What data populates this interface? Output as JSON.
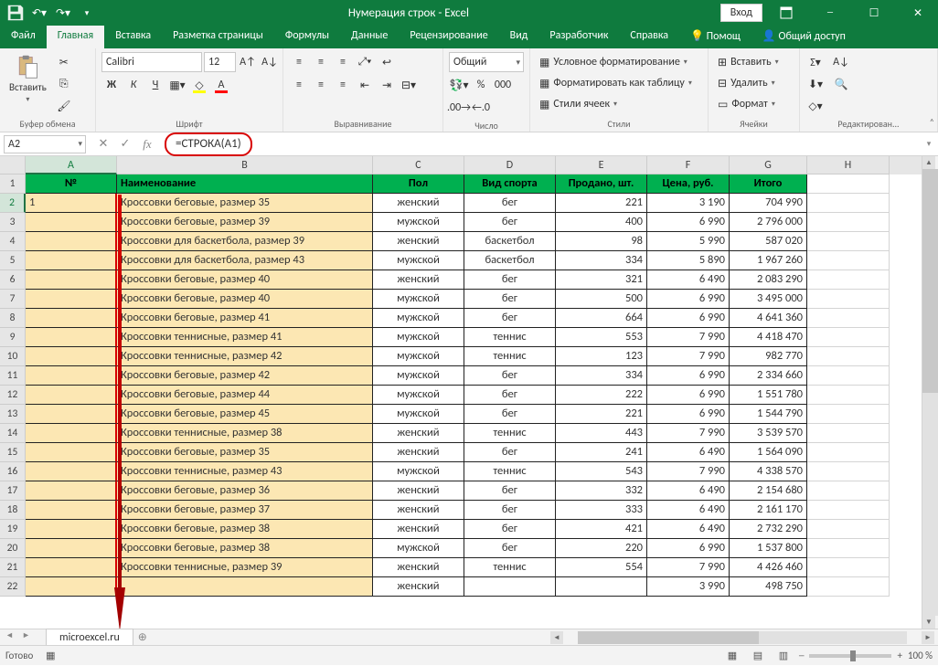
{
  "title": "Нумерация строк  -  Excel",
  "signin": "Вход",
  "tabs": [
    "Файл",
    "Главная",
    "Вставка",
    "Разметка страницы",
    "Формулы",
    "Данные",
    "Рецензирование",
    "Вид",
    "Разработчик",
    "Справка",
    "Помощ",
    "Общий доступ"
  ],
  "active_tab": 1,
  "ribbon": {
    "clipboard": {
      "paste": "Вставить",
      "label": "Буфер обмена"
    },
    "font": {
      "name": "Calibri",
      "size": "12",
      "label": "Шрифт",
      "bold": "Ж",
      "italic": "К",
      "underline": "Ч"
    },
    "align": {
      "label": "Выравнивание"
    },
    "number": {
      "format": "Общий",
      "label": "Число"
    },
    "styles": {
      "cond": "Условное форматирование",
      "table": "Форматировать как таблицу",
      "cell": "Стили ячеек",
      "label": "Стили"
    },
    "cells": {
      "insert": "Вставить",
      "delete": "Удалить",
      "format": "Формат",
      "label": "Ячейки"
    },
    "editing": {
      "label": "Редактирован..."
    }
  },
  "namebox": "A2",
  "formula": "=СТРОКА(A1)",
  "cols": {
    "A": 100,
    "B": 280,
    "C": 100,
    "D": 100,
    "E": 100,
    "F": 90,
    "G": 85,
    "H": 90
  },
  "headers": {
    "A": "№",
    "B": "Наименование",
    "C": "Пол",
    "D": "Вид спорта",
    "E": "Продано, шт.",
    "F": "Цена, руб.",
    "G": "Итого"
  },
  "a2": "1",
  "rows": [
    {
      "b": "Кроссовки беговые, размер 35",
      "c": "женский",
      "d": "бег",
      "e": "221",
      "f": "3 190",
      "g": "704 990"
    },
    {
      "b": "Кроссовки беговые, размер 39",
      "c": "мужской",
      "d": "бег",
      "e": "400",
      "f": "6 990",
      "g": "2 796 000"
    },
    {
      "b": "Кроссовки для баскетбола, размер 39",
      "c": "женский",
      "d": "баскетбол",
      "e": "98",
      "f": "5 990",
      "g": "587 020"
    },
    {
      "b": "Кроссовки для баскетбола, размер 43",
      "c": "мужской",
      "d": "баскетбол",
      "e": "334",
      "f": "5 890",
      "g": "1 967 260"
    },
    {
      "b": "Кроссовки беговые, размер 40",
      "c": "женский",
      "d": "бег",
      "e": "321",
      "f": "6 490",
      "g": "2 083 290"
    },
    {
      "b": "Кроссовки беговые, размер 40",
      "c": "мужской",
      "d": "бег",
      "e": "500",
      "f": "6 990",
      "g": "3 495 000"
    },
    {
      "b": "Кроссовки беговые, размер 41",
      "c": "мужской",
      "d": "бег",
      "e": "664",
      "f": "6 990",
      "g": "4 641 360"
    },
    {
      "b": "Кроссовки теннисные, размер 41",
      "c": "мужской",
      "d": "теннис",
      "e": "553",
      "f": "7 990",
      "g": "4 418 470"
    },
    {
      "b": "Кроссовки теннисные, размер 42",
      "c": "мужской",
      "d": "теннис",
      "e": "123",
      "f": "7 990",
      "g": "982 770"
    },
    {
      "b": "Кроссовки беговые, размер 42",
      "c": "мужской",
      "d": "бег",
      "e": "334",
      "f": "6 990",
      "g": "2 334 660"
    },
    {
      "b": "Кроссовки беговые, размер 44",
      "c": "мужской",
      "d": "бег",
      "e": "222",
      "f": "6 990",
      "g": "1 551 780"
    },
    {
      "b": "Кроссовки беговые, размер 45",
      "c": "мужской",
      "d": "бег",
      "e": "221",
      "f": "6 990",
      "g": "1 544 790"
    },
    {
      "b": "Кроссовки теннисные, размер 38",
      "c": "женский",
      "d": "теннис",
      "e": "443",
      "f": "7 990",
      "g": "3 539 570"
    },
    {
      "b": "Кроссовки беговые, размер 35",
      "c": "женский",
      "d": "бег",
      "e": "241",
      "f": "6 490",
      "g": "1 564 090"
    },
    {
      "b": "Кроссовки теннисные, размер 43",
      "c": "мужской",
      "d": "теннис",
      "e": "543",
      "f": "7 990",
      "g": "4 338 570"
    },
    {
      "b": "Кроссовки беговые, размер 36",
      "c": "женский",
      "d": "бег",
      "e": "332",
      "f": "6 490",
      "g": "2 154 680"
    },
    {
      "b": "Кроссовки беговые, размер 37",
      "c": "женский",
      "d": "бег",
      "e": "333",
      "f": "6 490",
      "g": "2 161 170"
    },
    {
      "b": "Кроссовки беговые, размер 38",
      "c": "женский",
      "d": "бег",
      "e": "421",
      "f": "6 490",
      "g": "2 732 290"
    },
    {
      "b": "Кроссовки беговые, размер 38",
      "c": "мужской",
      "d": "бег",
      "e": "220",
      "f": "6 990",
      "g": "1 537 800"
    },
    {
      "b": "Кроссовки теннисные, размер 39",
      "c": "женский",
      "d": "теннис",
      "e": "554",
      "f": "7 990",
      "g": "4 426 460"
    },
    {
      "b": "",
      "c": "женский",
      "d": "",
      "e": "",
      "f": "3 990",
      "g": "498 750"
    }
  ],
  "sheet": "microexcel.ru",
  "status": "Готово",
  "zoom": "100 %"
}
